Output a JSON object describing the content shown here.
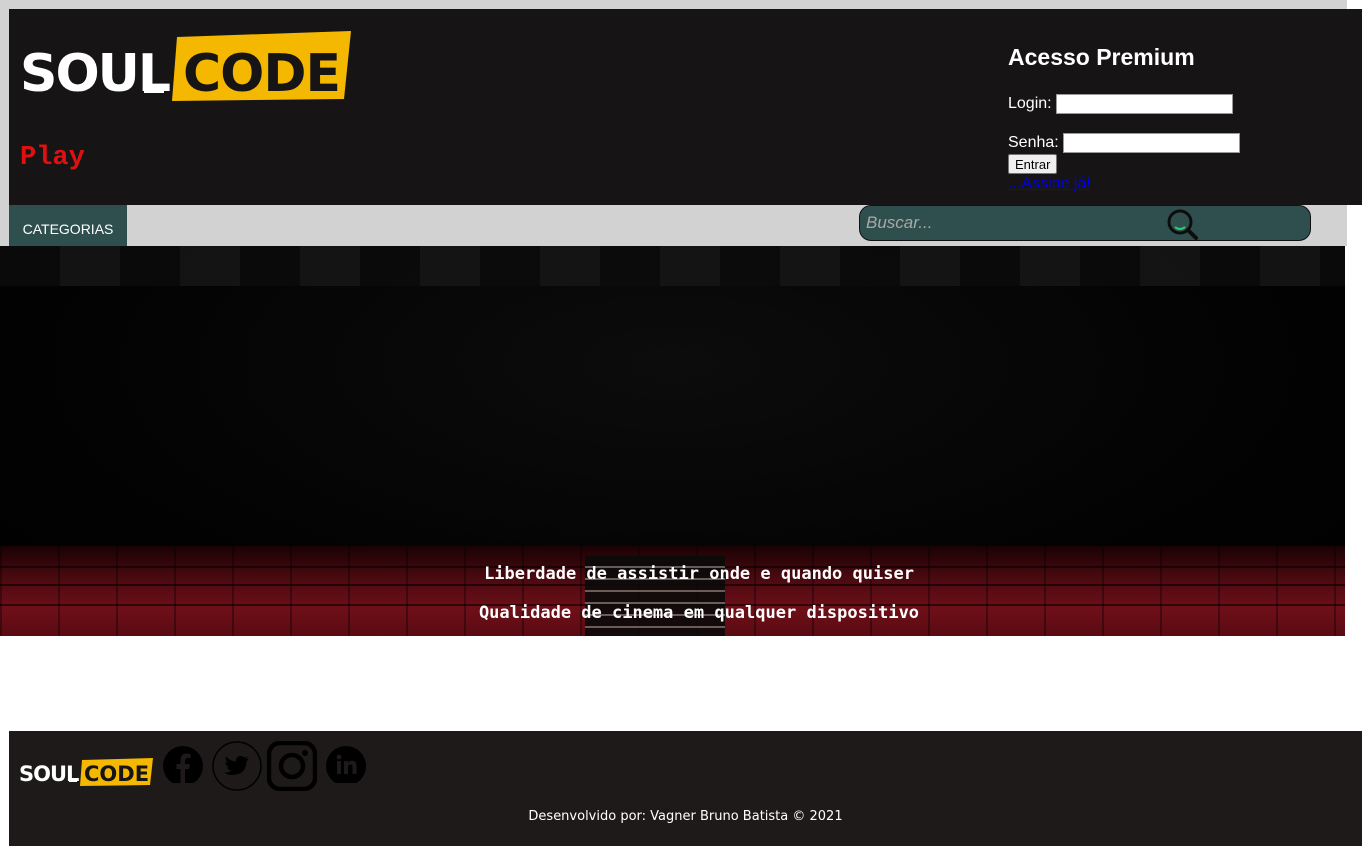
{
  "header": {
    "logo_left": "SOUL",
    "logo_right": "CODE",
    "subtitle": "Play"
  },
  "premium": {
    "title": "Acesso Premium",
    "login_label": "Login:",
    "senha_label": "Senha:",
    "login_value": "",
    "senha_value": "",
    "submit_label": "Entrar",
    "signup_link": "...Assine já!"
  },
  "nav": {
    "categories_label": "CATEGORIAS"
  },
  "search": {
    "placeholder": "Buscar...",
    "icon": "search-icon"
  },
  "hero": {
    "line1": "Liberdade de assistir onde e quando quiser",
    "line2": "Qualidade de cinema em qualquer dispositivo"
  },
  "footer": {
    "logo_left": "SOUL",
    "logo_right": "CODE",
    "social_icons": [
      "facebook-icon",
      "twitter-icon",
      "instagram-icon",
      "linkedin-icon"
    ],
    "credits": "Desenvolvido por: Vagner Bruno Batista © 2021"
  },
  "colors": {
    "header_bg": "#161415",
    "accent_yellow": "#f5b800",
    "play_red": "#e01010",
    "nav_bg": "#2f4f4f",
    "footer_bg": "#1e1a1a"
  }
}
